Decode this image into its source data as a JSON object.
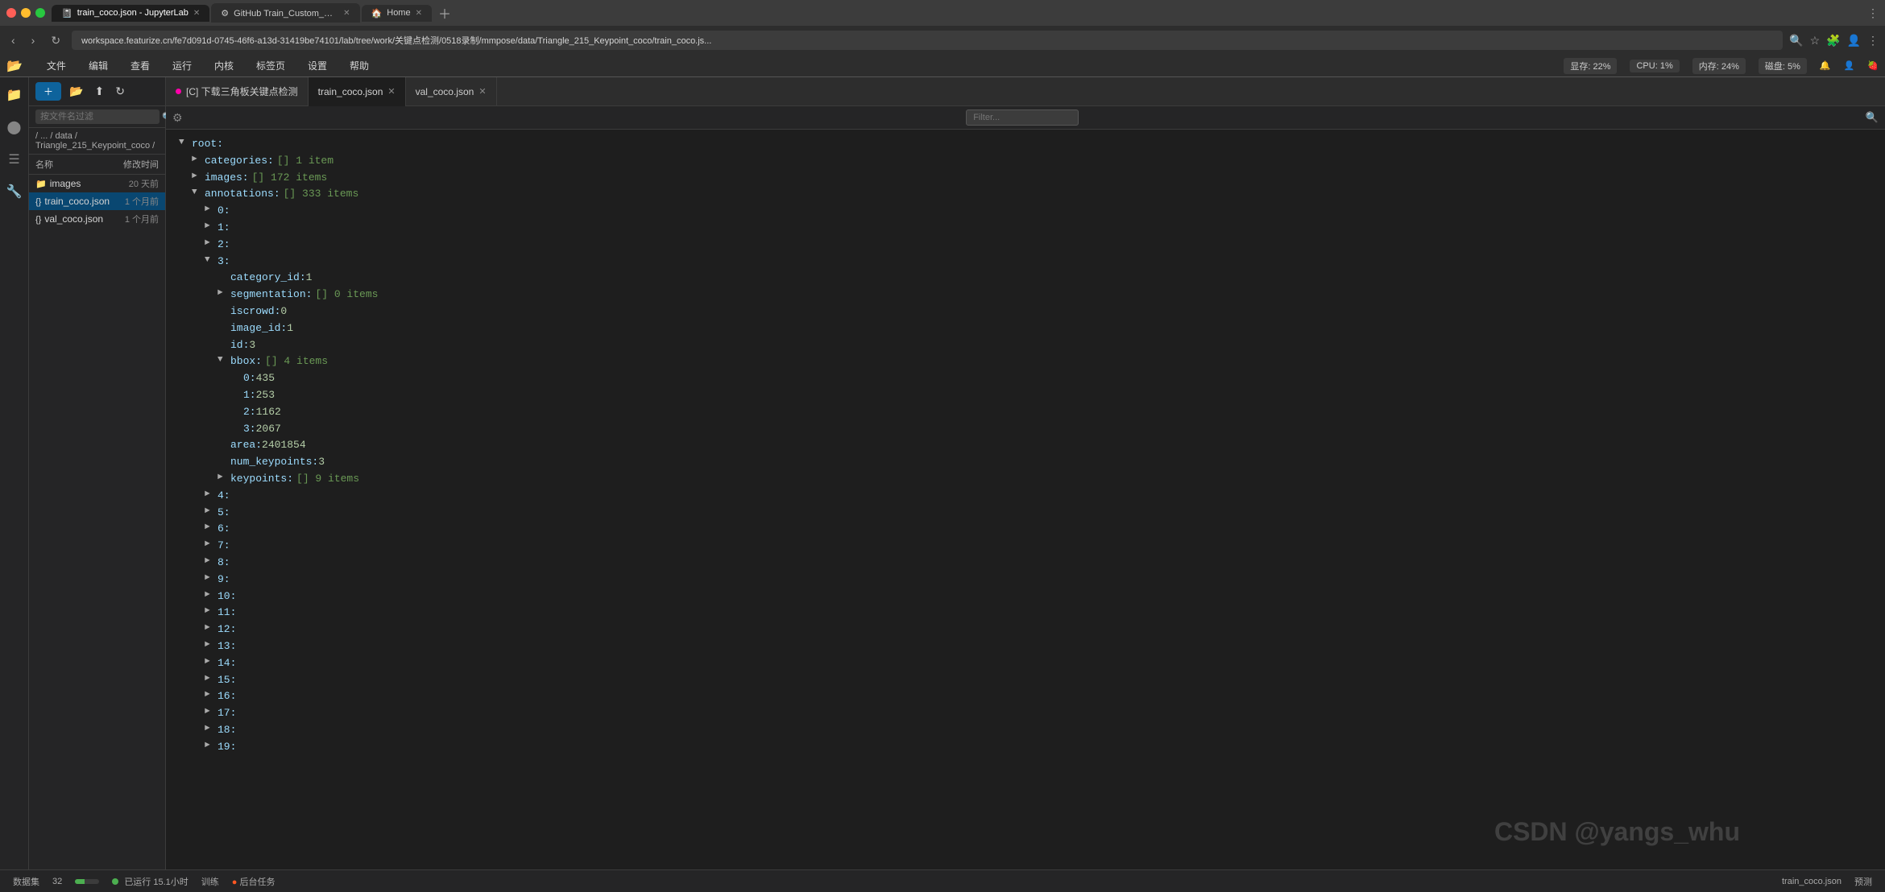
{
  "browser": {
    "tabs": [
      {
        "id": "tab1",
        "label": "train_coco.json - JupyterLab",
        "active": true,
        "favicon": "📓",
        "has_dot": true
      },
      {
        "id": "tab2",
        "label": "GitHub Train_Custom_Dataset/关键点",
        "active": false,
        "favicon": "⚙"
      },
      {
        "id": "tab3",
        "label": "Home",
        "active": false,
        "favicon": "🏠"
      }
    ],
    "url": "workspace.featurize.cn/fe7d091d-0745-46f6-a13d-31419be74101/lab/tree/work/关键点检测/0518录制/mmpose/data/Triangle_215_Keypoint_coco/train_coco.js...",
    "nav": {
      "back": "‹",
      "forward": "›",
      "refresh": "↻",
      "home": "⌂"
    }
  },
  "menu": {
    "items": [
      "文件",
      "编辑",
      "查看",
      "运行",
      "内核",
      "标签页",
      "设置",
      "帮助"
    ],
    "status_items": [
      {
        "label": "显存: 22%",
        "id": "vram"
      },
      {
        "label": "CPU: 1%",
        "id": "cpu"
      },
      {
        "label": "内存: 24%",
        "id": "mem"
      },
      {
        "label": "磁盘: 5%",
        "id": "disk"
      }
    ]
  },
  "sidebar": {
    "breadcrumb": "/ ... / data / Triangle_215_Keypoint_coco /",
    "search_placeholder": "按文件名过滤",
    "headers": {
      "name": "名称",
      "modified": "修改时间"
    },
    "files": [
      {
        "name": "images",
        "type": "folder",
        "date": "20 天前",
        "selected": false
      },
      {
        "name": "train_coco.json",
        "type": "json",
        "date": "1 个月前",
        "selected": true
      },
      {
        "name": "val_coco.json",
        "type": "json",
        "date": "1 个月前",
        "selected": false
      }
    ]
  },
  "json_tabs": [
    {
      "label": "[C] 下载三角板关键点检测",
      "active": false,
      "has_dot": true,
      "closeable": false
    },
    {
      "label": "train_coco.json",
      "active": true,
      "has_dot": false,
      "closeable": true
    },
    {
      "label": "val_coco.json",
      "active": false,
      "has_dot": false,
      "closeable": true
    }
  ],
  "filter_placeholder": "Filter...",
  "json_tree": {
    "root_label": "root:",
    "nodes": [
      {
        "id": "categories",
        "key": "categories:",
        "value": "[] 1 item",
        "indent": 1,
        "collapsed": true,
        "arrow": "►"
      },
      {
        "id": "images",
        "key": "images:",
        "value": "[] 172 items",
        "indent": 1,
        "collapsed": true,
        "arrow": "►"
      },
      {
        "id": "annotations",
        "key": "annotations:",
        "value": "[] 333 items",
        "indent": 1,
        "collapsed": false,
        "arrow": "▼"
      },
      {
        "id": "ann_0",
        "key": "0:",
        "value": "",
        "indent": 2,
        "collapsed": true,
        "arrow": "►"
      },
      {
        "id": "ann_1",
        "key": "1:",
        "value": "",
        "indent": 2,
        "collapsed": true,
        "arrow": "►"
      },
      {
        "id": "ann_2",
        "key": "2:",
        "value": "",
        "indent": 2,
        "collapsed": true,
        "arrow": "►"
      },
      {
        "id": "ann_3",
        "key": "3:",
        "value": "",
        "indent": 2,
        "collapsed": false,
        "arrow": "▼"
      },
      {
        "id": "category_id",
        "key": "category_id:",
        "value": "1",
        "indent": 3,
        "type": "number"
      },
      {
        "id": "segmentation",
        "key": "segmentation:",
        "value": "[] 0 items",
        "indent": 3,
        "collapsed": true,
        "arrow": "►"
      },
      {
        "id": "iscrowd",
        "key": "iscrowd:",
        "value": "0",
        "indent": 3,
        "type": "number"
      },
      {
        "id": "image_id",
        "key": "image_id:",
        "value": "1",
        "indent": 3,
        "type": "number"
      },
      {
        "id": "id_val",
        "key": "id:",
        "value": "3",
        "indent": 3,
        "type": "number"
      },
      {
        "id": "bbox",
        "key": "bbox:",
        "value": "[] 4 items",
        "indent": 3,
        "collapsed": false,
        "arrow": "▼"
      },
      {
        "id": "bbox_0",
        "key": "0:",
        "value": "435",
        "indent": 4,
        "type": "number"
      },
      {
        "id": "bbox_1",
        "key": "1:",
        "value": "253",
        "indent": 4,
        "type": "number"
      },
      {
        "id": "bbox_2",
        "key": "2:",
        "value": "1162",
        "indent": 4,
        "type": "number"
      },
      {
        "id": "bbox_3",
        "key": "3:",
        "value": "2067",
        "indent": 4,
        "type": "number"
      },
      {
        "id": "area",
        "key": "area:",
        "value": "2401854",
        "indent": 3,
        "type": "number"
      },
      {
        "id": "num_keypoints",
        "key": "num_keypoints:",
        "value": "3",
        "indent": 3,
        "type": "number"
      },
      {
        "id": "keypoints",
        "key": "keypoints:",
        "value": "[] 9 items",
        "indent": 3,
        "collapsed": true,
        "arrow": "►"
      },
      {
        "id": "ann_4",
        "key": "4:",
        "value": "",
        "indent": 2,
        "collapsed": true,
        "arrow": "►"
      },
      {
        "id": "ann_5",
        "key": "5:",
        "value": "",
        "indent": 2,
        "collapsed": true,
        "arrow": "►"
      },
      {
        "id": "ann_6",
        "key": "6:",
        "value": "",
        "indent": 2,
        "collapsed": true,
        "arrow": "►"
      },
      {
        "id": "ann_7",
        "key": "7:",
        "value": "",
        "indent": 2,
        "collapsed": true,
        "arrow": "►"
      },
      {
        "id": "ann_8",
        "key": "8:",
        "value": "",
        "indent": 2,
        "collapsed": true,
        "arrow": "►"
      },
      {
        "id": "ann_9",
        "key": "9:",
        "value": "",
        "indent": 2,
        "collapsed": true,
        "arrow": "►"
      },
      {
        "id": "ann_10",
        "key": "10:",
        "value": "",
        "indent": 2,
        "collapsed": true,
        "arrow": "►"
      },
      {
        "id": "ann_11",
        "key": "11:",
        "value": "",
        "indent": 2,
        "collapsed": true,
        "arrow": "►"
      },
      {
        "id": "ann_12",
        "key": "12:",
        "value": "",
        "indent": 2,
        "collapsed": true,
        "arrow": "►"
      },
      {
        "id": "ann_13",
        "key": "13:",
        "value": "",
        "indent": 2,
        "collapsed": true,
        "arrow": "►"
      },
      {
        "id": "ann_14",
        "key": "14:",
        "value": "",
        "indent": 2,
        "collapsed": true,
        "arrow": "►"
      },
      {
        "id": "ann_15",
        "key": "15:",
        "value": "",
        "indent": 2,
        "collapsed": true,
        "arrow": "►"
      },
      {
        "id": "ann_16",
        "key": "16:",
        "value": "",
        "indent": 2,
        "collapsed": true,
        "arrow": "►"
      },
      {
        "id": "ann_17",
        "key": "17:",
        "value": "",
        "indent": 2,
        "collapsed": true,
        "arrow": "►"
      },
      {
        "id": "ann_18",
        "key": "18:",
        "value": "",
        "indent": 2,
        "collapsed": true,
        "arrow": "►"
      },
      {
        "id": "ann_19",
        "key": "19:",
        "value": "",
        "indent": 2,
        "collapsed": true,
        "arrow": "►"
      }
    ]
  },
  "status_bar": {
    "left_items": [
      "数据集",
      "32",
      "已运行 15.1小时",
      "训练",
      "后台任务"
    ],
    "right_items": [
      "train_coco.json",
      "预测"
    ],
    "kernel_label": "已运行 15.1小时",
    "kernel_status": "active"
  },
  "watermark": "CSDN @yangs_whu"
}
